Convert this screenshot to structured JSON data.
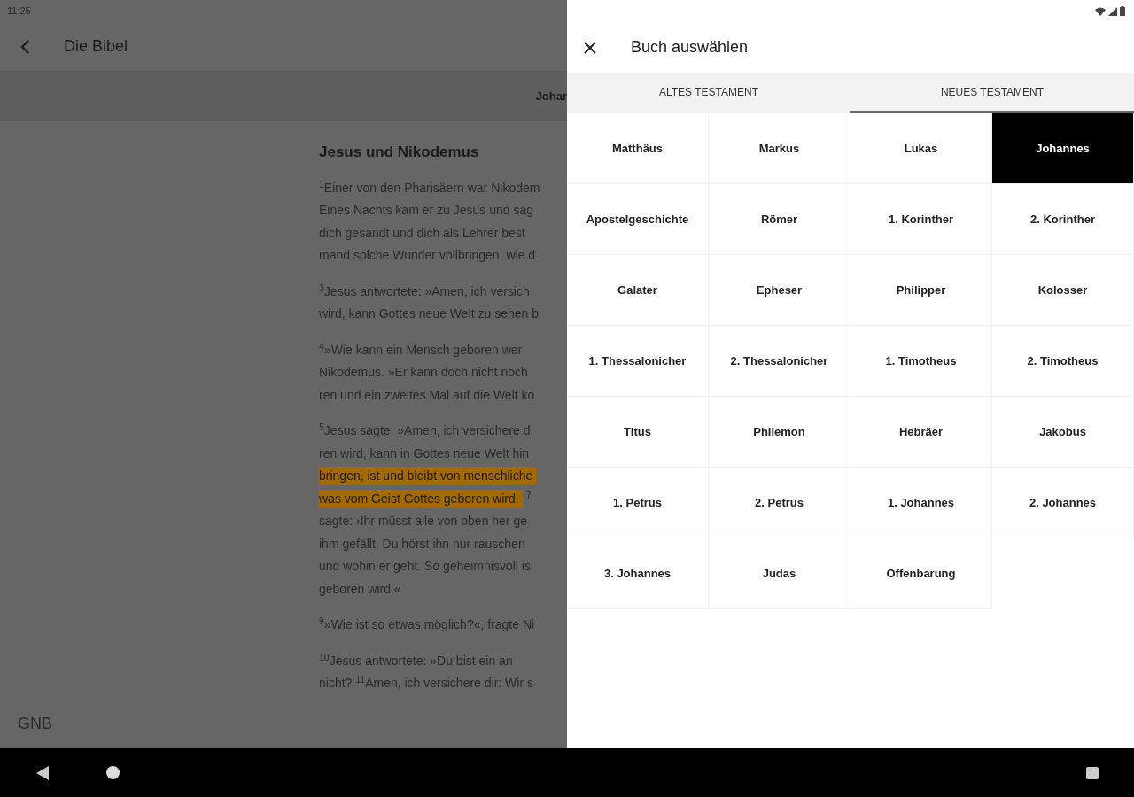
{
  "status_bar": {
    "time": "11:25"
  },
  "app_bar": {
    "title": "Die Bibel"
  },
  "chapter_bar": {
    "label": "Johar"
  },
  "reader": {
    "heading": "Jesus und Nikodemus",
    "paragraphs": [
      [
        [
          {
            "text": "$^{1}$Einer von den Pharisäern war Nikodem",
            "highlighted": false
          }
        ],
        [
          {
            "text": "Eines Nachts kam er zu Jesus und sag",
            "highlighted": false
          }
        ],
        [
          {
            "text": "dich gesandt und dich als Lehrer best",
            "highlighted": false
          }
        ],
        [
          {
            "text": "mand solche Wunder vollbringen, wie d",
            "highlighted": false
          }
        ]
      ],
      [
        [
          {
            "text": "$^{3}$Jesus antwortete: »Amen, ich versich",
            "highlighted": false
          }
        ],
        [
          {
            "text": "wird, kann Gottes neue Welt zu sehen b",
            "highlighted": false
          }
        ]
      ],
      [
        [
          {
            "text": "$^{4}$»Wie kann ein Mensch geboren wer",
            "highlighted": false
          }
        ],
        [
          {
            "text": "Nikodemus. »Er kann doch nicht noch",
            "highlighted": false
          }
        ],
        [
          {
            "text": "ren und ein zweites Mal auf die Welt ko",
            "highlighted": false
          }
        ]
      ],
      [
        [
          {
            "text": "$^{5}$Jesus sagte: »Amen, ich versichere d",
            "highlighted": false
          }
        ],
        [
          {
            "text": "ren wird, kann in Gottes neue Welt hin",
            "highlighted": false
          }
        ],
        [
          {
            "text": "bringen, ist und bleibt von menschliche",
            "highlighted": true
          }
        ],
        [
          {
            "text": "was vom Geist Gottes geboren wird.",
            "highlighted": true
          },
          {
            "text": "$^{7}$",
            "highlighted": false
          }
        ],
        [
          {
            "text": "sagte: ›Ihr müsst alle von oben her ge",
            "highlighted": false
          }
        ],
        [
          {
            "text": "ihm gefällt. Du hörst ihn nur rauschen",
            "highlighted": false
          }
        ],
        [
          {
            "text": "und wohin er geht. So geheimnisvoll is",
            "highlighted": false
          }
        ],
        [
          {
            "text": "geboren wird.«",
            "highlighted": false
          }
        ]
      ],
      [
        [
          {
            "text": "$^{9}$»Wie ist so etwas möglich?«, fragte Ni",
            "highlighted": false
          }
        ]
      ],
      [
        [
          {
            "text": "$^{10}$Jesus antwortete: »Du bist ein an",
            "highlighted": false
          }
        ],
        [
          {
            "text": "nicht?  $^{11}$Amen, ich versichere dir: Wir s",
            "highlighted": false
          }
        ]
      ]
    ]
  },
  "translation": "GNB",
  "book_picker": {
    "title": "Buch auswählen",
    "tabs": [
      {
        "label": "ALTES TESTAMENT",
        "selected": false
      },
      {
        "label": "NEUES TESTAMENT",
        "selected": true
      }
    ],
    "books": [
      {
        "name": "Matthäus",
        "selected": false
      },
      {
        "name": "Markus",
        "selected": false
      },
      {
        "name": "Lukas",
        "selected": false
      },
      {
        "name": "Johannes",
        "selected": true
      },
      {
        "name": "Apostelgeschichte",
        "selected": false
      },
      {
        "name": "Römer",
        "selected": false
      },
      {
        "name": "1. Korinther",
        "selected": false
      },
      {
        "name": "2. Korinther",
        "selected": false
      },
      {
        "name": "Galater",
        "selected": false
      },
      {
        "name": "Epheser",
        "selected": false
      },
      {
        "name": "Philipper",
        "selected": false
      },
      {
        "name": "Kolosser",
        "selected": false
      },
      {
        "name": "1. Thessalonicher",
        "selected": false
      },
      {
        "name": "2. Thessalonicher",
        "selected": false
      },
      {
        "name": "1. Timotheus",
        "selected": false
      },
      {
        "name": "2. Timotheus",
        "selected": false
      },
      {
        "name": "Titus",
        "selected": false
      },
      {
        "name": "Philemon",
        "selected": false
      },
      {
        "name": "Hebräer",
        "selected": false
      },
      {
        "name": "Jakobus",
        "selected": false
      },
      {
        "name": "1. Petrus",
        "selected": false
      },
      {
        "name": "2. Petrus",
        "selected": false
      },
      {
        "name": "1. Johannes",
        "selected": false
      },
      {
        "name": "2. Johannes",
        "selected": false
      },
      {
        "name": "3. Johannes",
        "selected": false
      },
      {
        "name": "Judas",
        "selected": false
      },
      {
        "name": "Offenbarung",
        "selected": false
      }
    ]
  }
}
